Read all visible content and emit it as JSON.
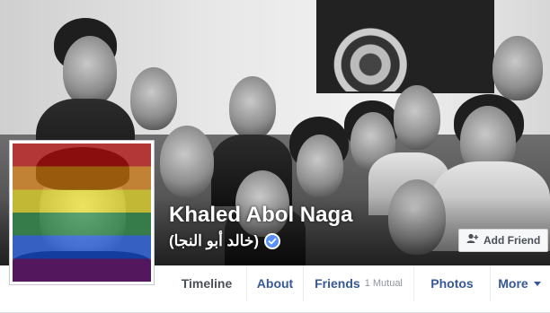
{
  "profile": {
    "name": "Khaled Abol Naga",
    "alt_name": "(خالد أبو النجا)",
    "verified": true
  },
  "actions": {
    "add_friend_label": "Add Friend"
  },
  "tabs": [
    {
      "label": "Timeline",
      "active": true
    },
    {
      "label": "About"
    },
    {
      "label": "Friends",
      "sub": "1 Mutual"
    },
    {
      "label": "Photos"
    },
    {
      "label": "More"
    }
  ],
  "colors": {
    "link": "#365899",
    "verified_badge": "#5890ff",
    "nav_text_active": "#4b4f56"
  },
  "icons": [
    "verified-badge-icon",
    "add-friend-icon",
    "chevron-down-icon"
  ]
}
